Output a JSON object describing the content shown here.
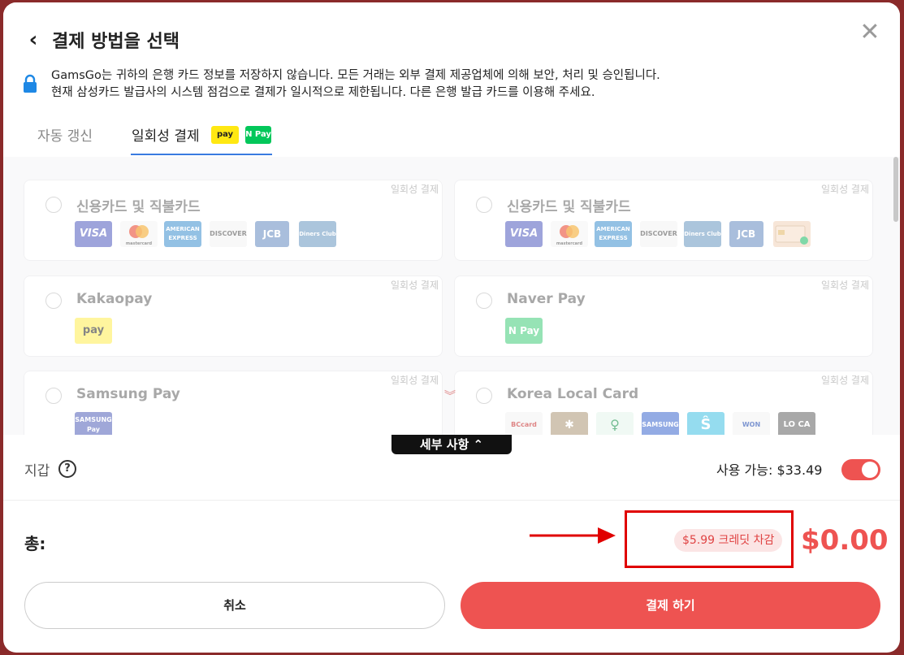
{
  "modal": {
    "title": "결제 방법을 선택",
    "notice_line1": "GamsGo는 귀하의 은행 카드 정보를 저장하지 않습니다. 모든 거래는 외부 결제 제공업체에 의해 보안, 처리 및 승인됩니다.",
    "notice_line2": "현재 삼성카드 발급사의 시스템 점검으로 결제가 일시적으로 제한됩니다. 다른 은행 발급 카드를 이용해 주세요."
  },
  "tabs": {
    "auto_renew": "자동 갱신",
    "one_time": "일회성 결제",
    "kakao_badge": "pay",
    "naver_badge": "N Pay"
  },
  "methods": {
    "tag": "일회성 결제",
    "credit_card_a": "신용카드 및 직불카드",
    "credit_card_b": "신용카드 및 직불카드",
    "kakaopay": "Kakaopay",
    "naverpay": "Naver Pay",
    "samsungpay": "Samsung Pay",
    "korea_local": "Korea Local Card"
  },
  "logos": {
    "visa": "VISA",
    "mastercard": "mastercard",
    "amex": "AMERICAN EXPRESS",
    "discover": "DISCOVER",
    "jcb": "JCB",
    "diners": "Diners Club",
    "kakao": "pay",
    "naver": "N Pay",
    "samsung": "SAMSUNG Pay",
    "bc": "BCcard",
    "samsung_card": "SAMSUNG",
    "woori": "WON",
    "loca": "LO CA"
  },
  "details_button": "세부 사항 ⌃",
  "wallet": {
    "label": "지갑",
    "available": "사용 가능: $33.49",
    "toggle_on": true
  },
  "total": {
    "label": "총:",
    "credit_deduction": "$5.99 크레딧 차감",
    "amount": "$0.00"
  },
  "buttons": {
    "cancel": "취소",
    "pay": "결제 하기"
  },
  "colors": {
    "accent": "#ee5351",
    "tab_underline": "#3a7be0",
    "highlight_box": "#e00000"
  }
}
